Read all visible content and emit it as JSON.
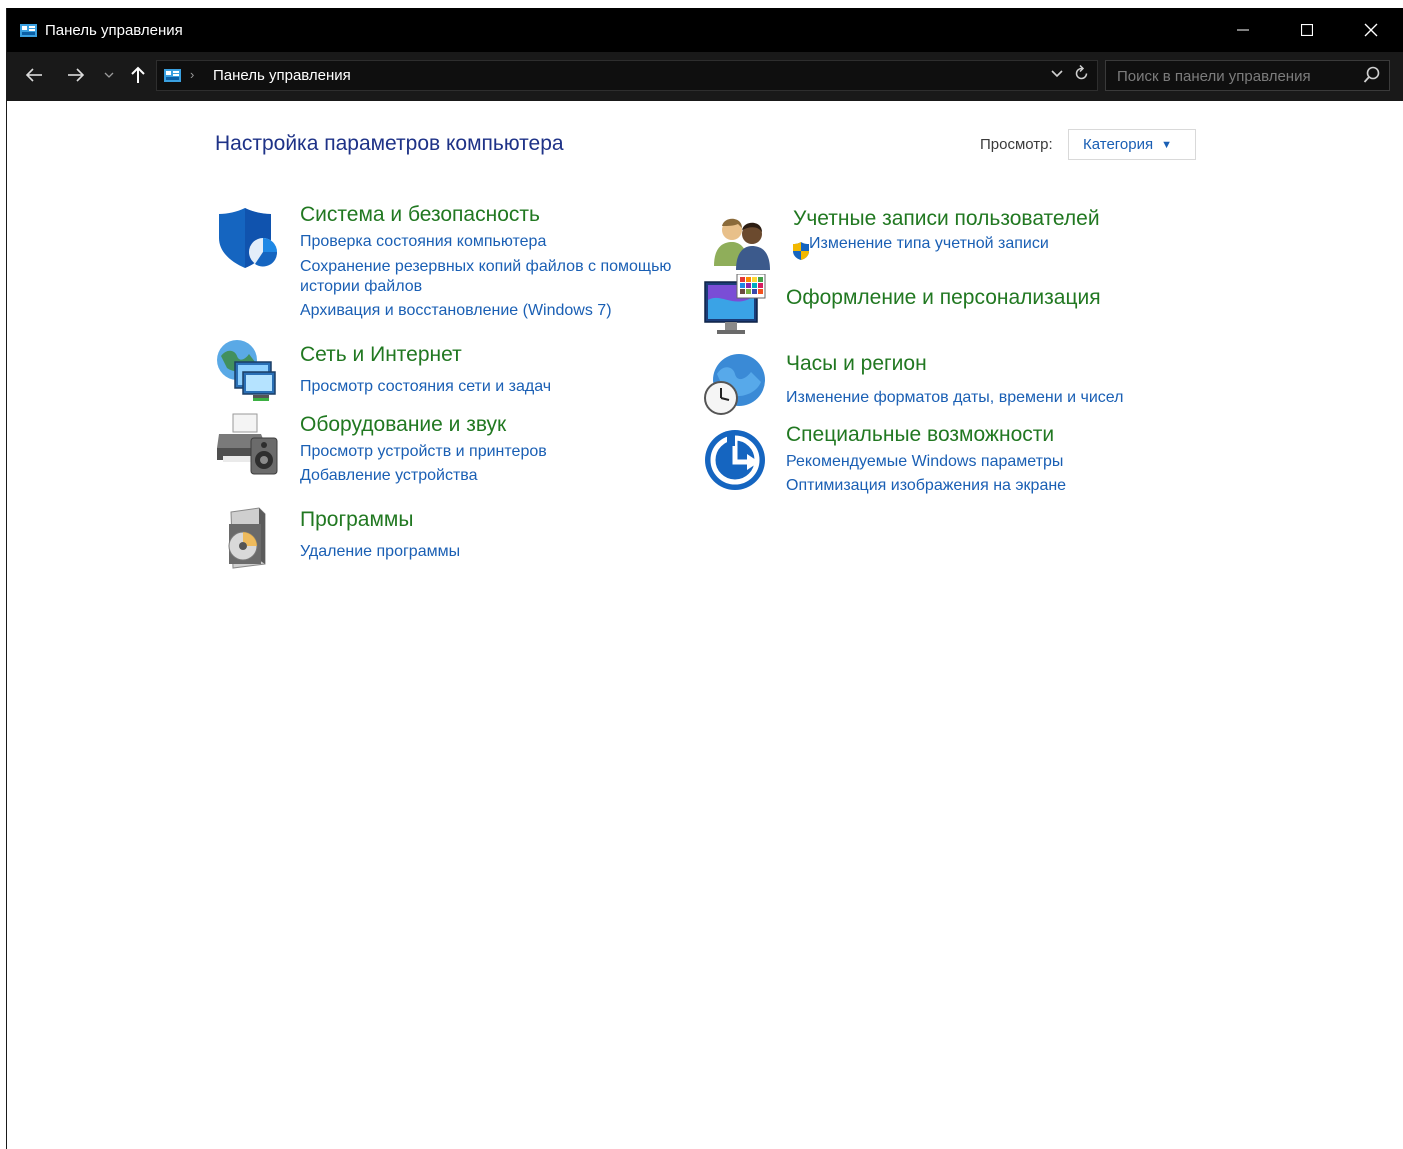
{
  "window": {
    "title": "Панель управления"
  },
  "addressbar": {
    "path": [
      "Панель управления"
    ],
    "search_placeholder": "Поиск в панели управления"
  },
  "main": {
    "heading": "Настройка параметров компьютера",
    "view_by_label": "Просмотр:",
    "view_by_value": "Категория",
    "categories": [
      {
        "title": "Система и безопасность",
        "icon": "shield-icon",
        "links": [
          "Проверка состояния компьютера",
          "Сохранение резервных копий файлов с помощью истории файлов",
          "Архивация и восстановление (Windows 7)"
        ]
      },
      {
        "title": "Сеть и Интернет",
        "icon": "network-globe-icon",
        "links": [
          "Просмотр состояния сети и задач"
        ]
      },
      {
        "title": "Оборудование и звук",
        "icon": "printer-speaker-icon",
        "links": [
          "Просмотр устройств и принтеров",
          "Добавление устройства"
        ]
      },
      {
        "title": "Программы",
        "icon": "programs-disc-icon",
        "links": [
          "Удаление программы"
        ]
      },
      {
        "title": "Учетные записи пользователей",
        "icon": "users-icon",
        "links": [
          "Изменение типа учетной записи"
        ]
      },
      {
        "title": "Оформление и персонализация",
        "icon": "monitor-palette-icon",
        "links": []
      },
      {
        "title": "Часы и регион",
        "icon": "clock-globe-icon",
        "links": [
          "Изменение форматов даты, времени и чисел"
        ]
      },
      {
        "title": "Специальные возможности",
        "icon": "accessibility-icon",
        "links": [
          "Рекомендуемые Windows параметры",
          "Оптимизация изображения на экране"
        ]
      }
    ]
  },
  "colors": {
    "category_title": "#217821",
    "link": "#1a5fb4",
    "heading": "#1e3287",
    "titlebar": "#000000"
  }
}
